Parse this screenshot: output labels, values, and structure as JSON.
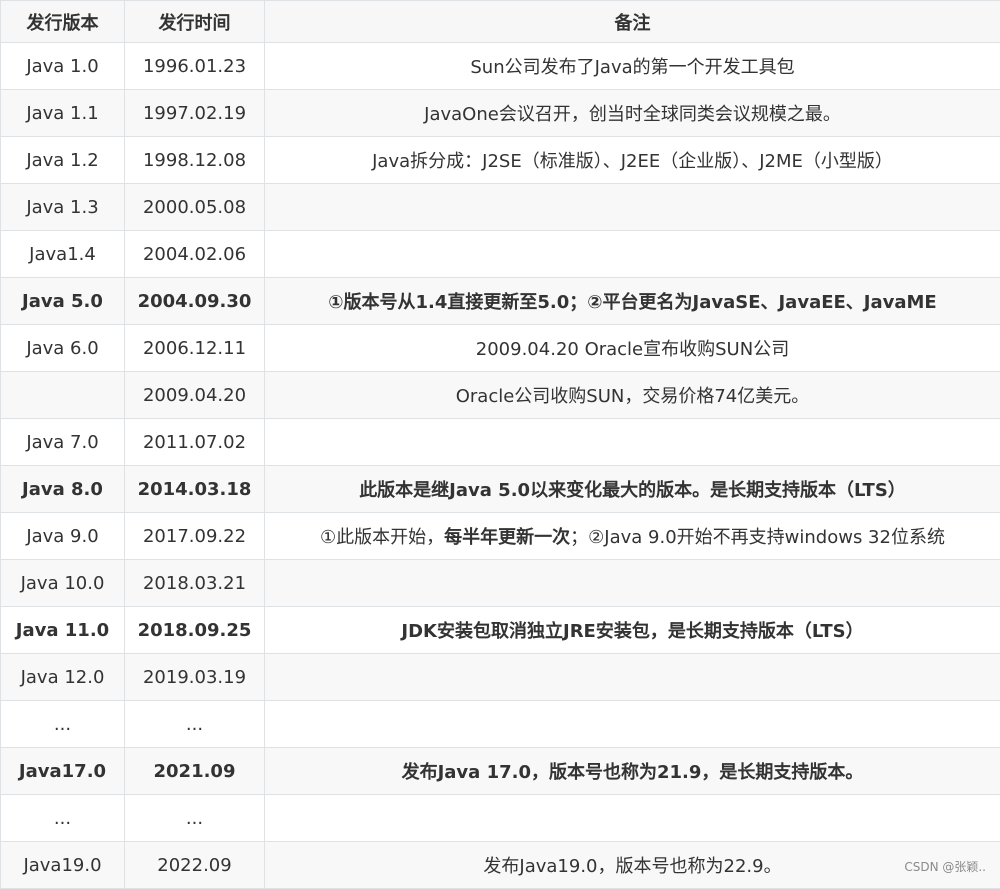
{
  "table": {
    "headers": [
      "发行版本",
      "发行时间",
      "备注"
    ],
    "rows": [
      {
        "version": "Java 1.0",
        "date": "1996.01.23",
        "note": [
          {
            "text": "Sun公司发布了Java的第一个开发工具包",
            "bold": false
          }
        ],
        "bold": false
      },
      {
        "version": "Java 1.1",
        "date": "1997.02.19",
        "note": [
          {
            "text": "JavaOne会议召开，创当时全球同类会议规模之最。",
            "bold": false
          }
        ],
        "bold": false
      },
      {
        "version": "Java 1.2",
        "date": "1998.12.08",
        "note": [
          {
            "text": "Java拆分成：J2SE（标准版）、J2EE（企业版）、J2ME（小型版）",
            "bold": false
          }
        ],
        "bold": false
      },
      {
        "version": "Java 1.3",
        "date": "2000.05.08",
        "note": [],
        "bold": false
      },
      {
        "version": "Java1.4",
        "date": "2004.02.06",
        "note": [],
        "bold": false
      },
      {
        "version": "Java 5.0",
        "date": "2004.09.30",
        "note": [
          {
            "text": "①版本号从1.4直接更新至5.0；②平台更名为JavaSE、JavaEE、JavaME",
            "bold": true
          }
        ],
        "bold": true
      },
      {
        "version": "Java 6.0",
        "date": "2006.12.11",
        "note": [
          {
            "text": "2009.04.20 Oracle宣布收购SUN公司",
            "bold": false
          }
        ],
        "bold": false
      },
      {
        "version": "",
        "date": "2009.04.20",
        "note": [
          {
            "text": "Oracle公司收购SUN，交易价格74亿美元。",
            "bold": false
          }
        ],
        "bold": false
      },
      {
        "version": "Java 7.0",
        "date": "2011.07.02",
        "note": [],
        "bold": false
      },
      {
        "version": "Java 8.0",
        "date": "2014.03.18",
        "note": [
          {
            "text": "此版本是继Java 5.0以来变化最大的版本。是长期支持版本（LTS）",
            "bold": true
          }
        ],
        "bold": true
      },
      {
        "version": "Java 9.0",
        "date": "2017.09.22",
        "note": [
          {
            "text": "①此版本开始，",
            "bold": false
          },
          {
            "text": "每半年更新一次",
            "bold": true
          },
          {
            "text": "；②Java 9.0开始不再支持windows 32位系统",
            "bold": false
          }
        ],
        "bold": false
      },
      {
        "version": "Java 10.0",
        "date": "2018.03.21",
        "note": [],
        "bold": false
      },
      {
        "version": "Java 11.0",
        "date": "2018.09.25",
        "note": [
          {
            "text": "JDK安装包取消独立JRE安装包，是长期支持版本（LTS）",
            "bold": true
          }
        ],
        "bold": true
      },
      {
        "version": "Java 12.0",
        "date": "2019.03.19",
        "note": [],
        "bold": false
      },
      {
        "version": "...",
        "date": "...",
        "note": [],
        "bold": false
      },
      {
        "version": "Java17.0",
        "date": "2021.09",
        "note": [
          {
            "text": "发布Java 17.0，版本号也称为21.9，是长期支持版本。",
            "bold": true
          }
        ],
        "bold": true
      },
      {
        "version": "...",
        "date": "...",
        "note": [],
        "bold": false
      },
      {
        "version": "Java19.0",
        "date": "2022.09",
        "note": [
          {
            "text": "发布Java19.0，版本号也称为22.9。",
            "bold": false
          }
        ],
        "bold": false
      }
    ]
  },
  "watermark": "CSDN @张颖.."
}
